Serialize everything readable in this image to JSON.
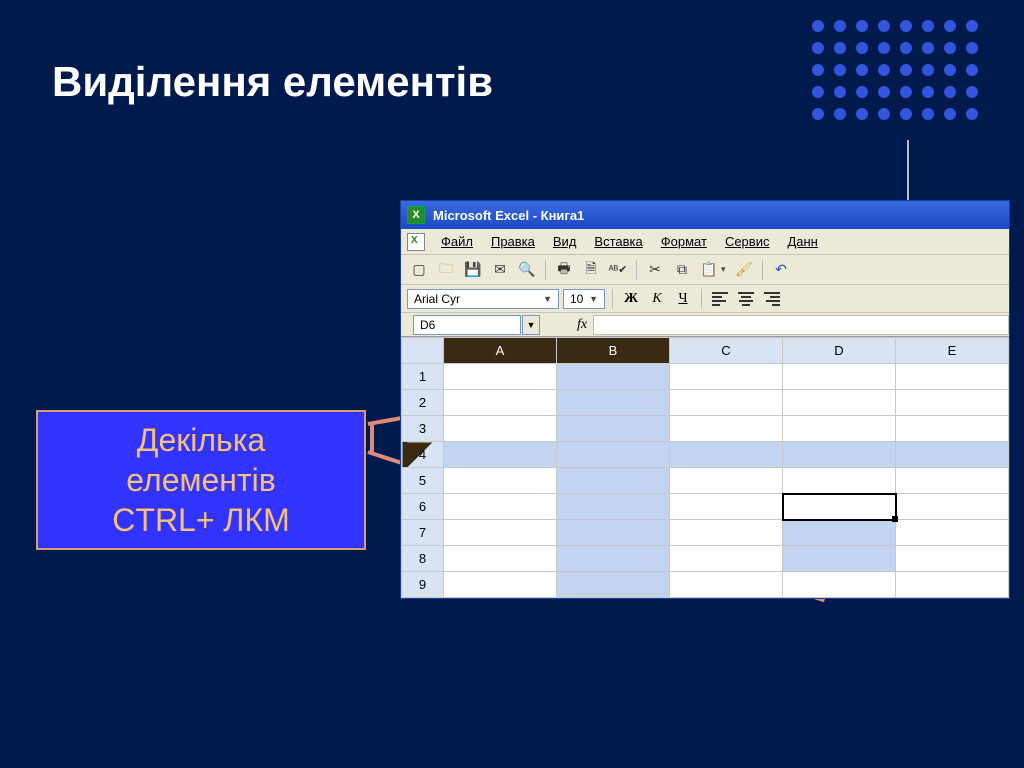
{
  "slide": {
    "title": "Виділення елементів",
    "callout_line1": "Декілька",
    "callout_line2": "елементів",
    "callout_line3": "CTRL+ ЛКМ"
  },
  "excel": {
    "title": "Microsoft Excel - Книга1",
    "menu": {
      "file": "Файл",
      "edit": "Правка",
      "view": "Вид",
      "insert": "Вставка",
      "format": "Формат",
      "tools": "Сервис",
      "data": "Данн"
    },
    "format_bar": {
      "font_name": "Arial Cyr",
      "font_size": "10",
      "bold": "Ж",
      "italic": "К",
      "underline": "Ч"
    },
    "name_box": "D6",
    "fx_label": "fx",
    "columns": [
      "A",
      "B",
      "C",
      "D",
      "E"
    ],
    "rows": [
      "1",
      "2",
      "3",
      "4",
      "5",
      "6",
      "7",
      "8",
      "9"
    ],
    "selection": {
      "whole_column": "B",
      "whole_row": "4",
      "range_cols": [
        "D"
      ],
      "range_rows": [
        "6",
        "7",
        "8"
      ],
      "active_cell": "D6"
    }
  }
}
